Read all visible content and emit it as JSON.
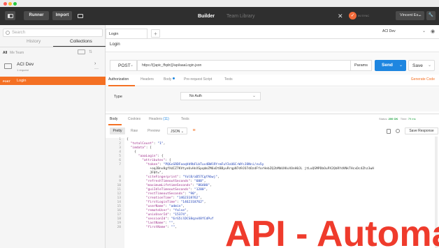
{
  "header": {
    "runner_label": "Runner",
    "import_label": "Import",
    "builder_tab": "Builder",
    "team_tab": "Team Library",
    "sync_badge": "✓",
    "sync_text": "IN SYNC",
    "user_label": "Vincent Es...",
    "icons": [
      "sidebar-toggle-icon",
      "new-window-icon",
      "satellite-icon",
      "wrench-icon",
      "heart-icon"
    ]
  },
  "sidebar": {
    "search_placeholder": "Search",
    "tabs": [
      "History",
      "Collections"
    ],
    "filters": [
      "All",
      "Me",
      "Team"
    ],
    "collection": {
      "name": "ACI Dev",
      "count": "1 request"
    },
    "request": {
      "method": "POST",
      "name": "Login"
    }
  },
  "main": {
    "tab_label": "Login",
    "tab_add": "+",
    "environment": "ACI Dev",
    "request_title": "Login",
    "method": "POST",
    "url": "https://{{apic_ffqdn}}/api/aaaLogin.json",
    "params_label": "Params",
    "send_label": "Send",
    "save_label": "Save",
    "request_tabs": [
      "Authorization",
      "Headers",
      "Body",
      "Pre-request Script",
      "Tests"
    ],
    "generate_code": "Generate Code",
    "auth_type_label": "Type",
    "auth_type_value": "No Auth"
  },
  "response": {
    "tabs": [
      "Body",
      "Cookies",
      "Headers"
    ],
    "headers_count": "(11)",
    "tests_tab": "Tests",
    "status_label": "Status:",
    "status_value": "200 OK",
    "time_label": "Time:",
    "time_value": "79 ms",
    "view_modes": [
      "Pretty",
      "Raw",
      "Preview"
    ],
    "format": "JSON",
    "save_response": "Save Response",
    "code_lines": [
      {
        "n": "1",
        "t": "{"
      },
      {
        "n": "2",
        "t": "  \"totalCount\": \"1\","
      },
      {
        "n": "3",
        "t": "  \"imdata\": ["
      },
      {
        "n": "4",
        "t": "    {"
      },
      {
        "n": "5",
        "t": "      \"aaaLogin\": {"
      },
      {
        "n": "6",
        "t": "        \"attributes\": {"
      },
      {
        "n": "7",
        "t": "          \"token\": \"PQGcGRDFooqVd9bFLbTuv4BWlRY+mFuY3vU6C+WYcJONni/zu5y"
      },
      {
        "n": "",
        "t": "            +oqJBnv8gfXdIZ7KVtyeUvHnXSpqdmZM6xDtBByuRrqpN7d9JO7dOzdFforHebZQ2bMbUXKxXOnH0JL jtLuQSMPDbOuPX2QbRYdVNkTHcxDc4Zhz3wH"
      },
      {
        "n": "",
        "t": "            JF0Y=\","
      },
      {
        "n": "8",
        "t": "          \"siteFingerprint\": \"YolB/aD57CgfAbwj\","
      },
      {
        "n": "9",
        "t": "          \"refreshTimeoutSeconds\": \"600\","
      },
      {
        "n": "10",
        "t": "          \"maximumLifetimeSeconds\": \"86400\","
      },
      {
        "n": "11",
        "t": "          \"guiIdleTimeoutSeconds\": \"1200\","
      },
      {
        "n": "12",
        "t": "          \"restTimeoutSeconds\": \"90\","
      },
      {
        "n": "13",
        "t": "          \"creationTime\": \"1462318762\","
      },
      {
        "n": "14",
        "t": "          \"firstLoginTime\": \"1462318762\","
      },
      {
        "n": "15",
        "t": "          \"userName\": \"admin\","
      },
      {
        "n": "16",
        "t": "          \"remoteUser\": \"false\","
      },
      {
        "n": "17",
        "t": "          \"unixUserId\": \"15374\","
      },
      {
        "n": "18",
        "t": "          \"sessionId\": \"6rG5ilDCS8qzeX8fCdPuf"
      },
      {
        "n": "19",
        "t": "          \"lastName\": \"\","
      },
      {
        "n": "20",
        "t": "          \"firstName\": \"\","
      }
    ]
  },
  "watermark": "API - Automa",
  "colors": {
    "accent_orange": "#f47023",
    "send_blue": "#1e86e0",
    "status_green": "#1a9f3c",
    "watermark_red": "#ef3b2c",
    "header_dark": "#2f2f2f"
  }
}
